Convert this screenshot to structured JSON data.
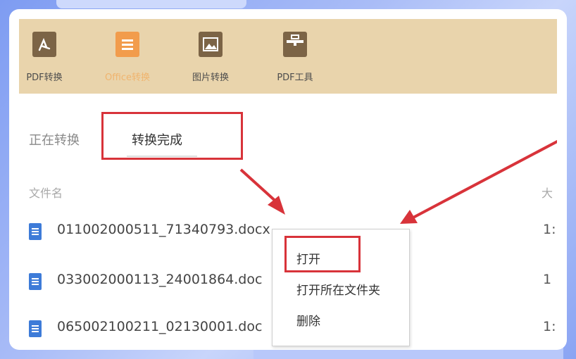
{
  "toolbar": {
    "items": [
      {
        "label": "PDF转换",
        "icon": "pdf-icon"
      },
      {
        "label": "Office转换",
        "icon": "office-doc-icon"
      },
      {
        "label": "图片转换",
        "icon": "image-icon"
      },
      {
        "label": "PDF工具",
        "icon": "toolbox-icon"
      }
    ],
    "active_index": 1
  },
  "tabs": {
    "converting": "正在转换",
    "done": "转换完成"
  },
  "table": {
    "headers": {
      "name": "文件名",
      "size": "大"
    },
    "rows": [
      {
        "name": "011002000511_71340793.docx",
        "size": "1:"
      },
      {
        "name": "033002000113_24001864.doc",
        "size": "1"
      },
      {
        "name": "065002100211_02130001.doc",
        "size": "1:"
      }
    ]
  },
  "context_menu": {
    "open": "打开",
    "open_folder": "打开所在文件夹",
    "delete": "删除"
  },
  "colors": {
    "toolbar_bg": "#e9d4ac",
    "highlight": "#d8333a",
    "active_tab_text": "#f0b46e",
    "doc_icon": "#3d7bd8"
  }
}
